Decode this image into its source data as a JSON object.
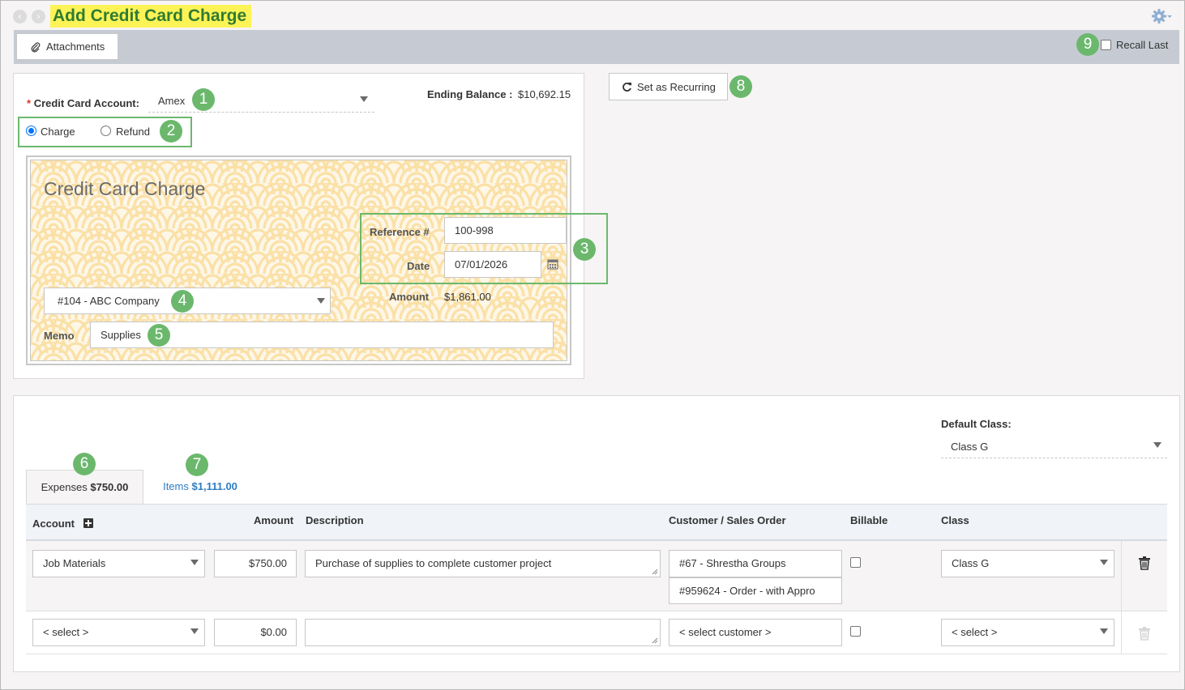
{
  "window": {
    "title": "Add Credit Card Charge"
  },
  "toolbar": {
    "attachments_label": "Attachments",
    "recall_last_label": "Recall Last",
    "recall_last_checked": false
  },
  "badges": [
    "1",
    "2",
    "3",
    "4",
    "5",
    "6",
    "7",
    "8",
    "9"
  ],
  "form": {
    "credit_card_account_label": "Credit Card Account:",
    "required_marker": "*",
    "credit_card_account_value": "Amex",
    "ending_balance_label": "Ending Balance :",
    "ending_balance_value": "$10,692.15",
    "type_options": [
      "Charge",
      "Refund"
    ],
    "type_selected": "Charge",
    "set_recurring_label": "Set as Recurring"
  },
  "check": {
    "title": "Credit Card Charge",
    "reference_label": "Reference #",
    "reference_value": "100-998",
    "date_label": "Date",
    "date_value": "07/01/2026",
    "amount_label": "Amount",
    "amount_value": "$1,861.00",
    "vendor_value": "#104 - ABC Company",
    "memo_label": "Memo",
    "memo_value": "Supplies"
  },
  "lines": {
    "default_class_label": "Default Class:",
    "default_class_value": "Class G",
    "tabs": [
      {
        "label": "Expenses",
        "amount": "$750.00",
        "active": true
      },
      {
        "label": "Items",
        "amount": "$1,111.00",
        "active": false
      }
    ],
    "columns": [
      "Account",
      "Amount",
      "Description",
      "Customer / Sales Order",
      "Billable",
      "Class"
    ],
    "rows": [
      {
        "account": "Job Materials",
        "amount": "$750.00",
        "description": "Purchase of supplies to complete customer project",
        "customer": "#67 - Shrestha Groups",
        "sales_order": "#959624 - Order - with Appro",
        "billable": false,
        "class": "Class G"
      },
      {
        "account": "< select >",
        "amount": "$0.00",
        "description": "",
        "customer": "< select customer >",
        "billable": false,
        "class": "< select >"
      }
    ]
  },
  "colors": {
    "accent_green": "#6bb86d",
    "title_highlight": "#fdf356",
    "title_text": "#2f7c32",
    "toolbar_bg": "#c6cbd3",
    "link_blue": "#2e7dc1",
    "pattern": "#fbe0a6"
  }
}
